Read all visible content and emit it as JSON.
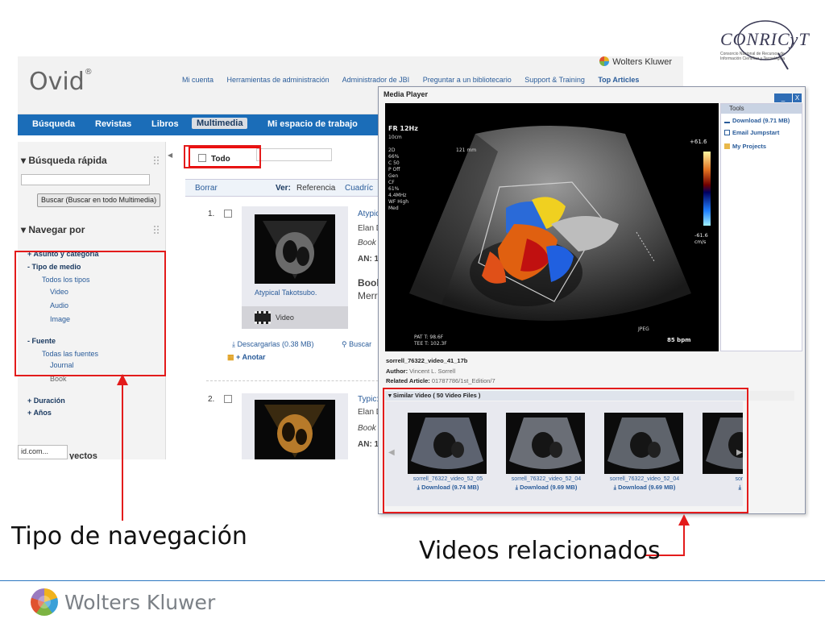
{
  "brand_logo": {
    "title": "CONRICyT",
    "subtitle": "Consorcio Nacional de Recursos de Información Científica y Tecnológica"
  },
  "ovid": {
    "logo": "Ovid",
    "publisher": "Wolters Kluwer",
    "top_links": [
      "Mi cuenta",
      "Herramientas de administración",
      "Administrador de JBI",
      "Preguntar a un bibliotecario",
      "Support & Training",
      "Top Articles"
    ],
    "nav_tabs": [
      "Búsqueda",
      "Revistas",
      "Libros",
      "Multimedia",
      "Mi espacio de trabajo"
    ],
    "active_tab": "Multimedia",
    "sidebar": {
      "quick_search": "Búsqueda rápida",
      "search_button": "Buscar (Buscar en todo Multimedia)",
      "browse_by": "Navegar por",
      "items": [
        {
          "prefix": "+",
          "label": "Asunto y categoría",
          "kind": "dark"
        },
        {
          "prefix": "-",
          "label": "Tipo de medio",
          "kind": "dark"
        },
        {
          "prefix": "",
          "label": "Todos los tipos",
          "kind": "link"
        },
        {
          "prefix": "",
          "label": "Video",
          "kind": "link"
        },
        {
          "prefix": "",
          "label": "Audio",
          "kind": "link"
        },
        {
          "prefix": "",
          "label": "Image",
          "kind": "link"
        },
        {
          "prefix": "-",
          "label": "Fuente",
          "kind": "dark"
        },
        {
          "prefix": "",
          "label": "Todas las fuentes",
          "kind": "link"
        },
        {
          "prefix": "",
          "label": "Journal",
          "kind": "link"
        },
        {
          "prefix": "",
          "label": "Book",
          "kind": "grey"
        },
        {
          "prefix": "+",
          "label": "Duración",
          "kind": "dark"
        },
        {
          "prefix": "+",
          "label": "Años",
          "kind": "dark"
        }
      ],
      "footer_url": "id.com...",
      "footer_text": "yectos"
    },
    "main": {
      "select_all": "Todo",
      "clear": "Borrar",
      "view_label": "Ver:",
      "view_reference": "Referencia",
      "view_grid": "Cuadríc",
      "results": [
        {
          "number": "1.",
          "thumb_caption": "Atypical Takotsubo.",
          "media_type": "Video",
          "title": "Atypic",
          "author": "Elan D",
          "source": "Book",
          "an": "AN: 1",
          "heading": "Book",
          "publisher": "Merri",
          "download": "Descargarlas (0.38 MB)",
          "search_link": "Buscar",
          "annotate": "Anotar"
        },
        {
          "number": "2.",
          "title": "Typic:",
          "author": "Elan D",
          "source": "Book",
          "an": "AN: 1"
        }
      ]
    }
  },
  "player": {
    "title": "Media Player",
    "window_buttons": [
      "_",
      "X"
    ],
    "tools_header": "Tools",
    "tools": [
      "Download (9.71 MB)",
      "Email Jumpstart",
      "My Projects"
    ],
    "overlay": {
      "fr": "FR 12Hz",
      "depth": "10cm",
      "params": [
        "2D",
        "66%",
        "C 50",
        "P Off",
        "Gen",
        "CF",
        "61%",
        "4.4MHz",
        "WF High",
        "Med"
      ],
      "scale_top": "+61.6",
      "scale_bottom": "-61.6",
      "scale_unit": "cm/s",
      "bpm": "85 bpm",
      "pat_temp": "PAT T: 98.6F",
      "tee_temp": "TEE T: 102.3F",
      "jpeg": "JPEG",
      "angle": "121 mm"
    },
    "video_name": "sorrell_76322_video_41_17b",
    "author_label": "Author:",
    "author": "Vincent L. Sorrell",
    "related_label": "Related Article:",
    "related": "01787786/1st_Edition/7",
    "similar_header": "Similar Video ( 50 Video Files )",
    "similar": [
      {
        "name": "sorrell_76322_video_52_05",
        "download": "Download (9.74 MB)"
      },
      {
        "name": "sorrell_76322_video_52_04",
        "download": "Download (9.69 MB)"
      },
      {
        "name": "sorrell_76322_video_52_04",
        "download": "Download (9.69 MB)"
      },
      {
        "name": "sorrell",
        "download": "D"
      }
    ]
  },
  "annotations": {
    "left": "Tipo de navegación",
    "right": "Videos relacionados"
  },
  "footer": {
    "company": "Wolters Kluwer"
  },
  "colors": {
    "highlight": "#e31b1b",
    "ovid_nav": "#1b6db8",
    "rule": "#2d77c1"
  }
}
